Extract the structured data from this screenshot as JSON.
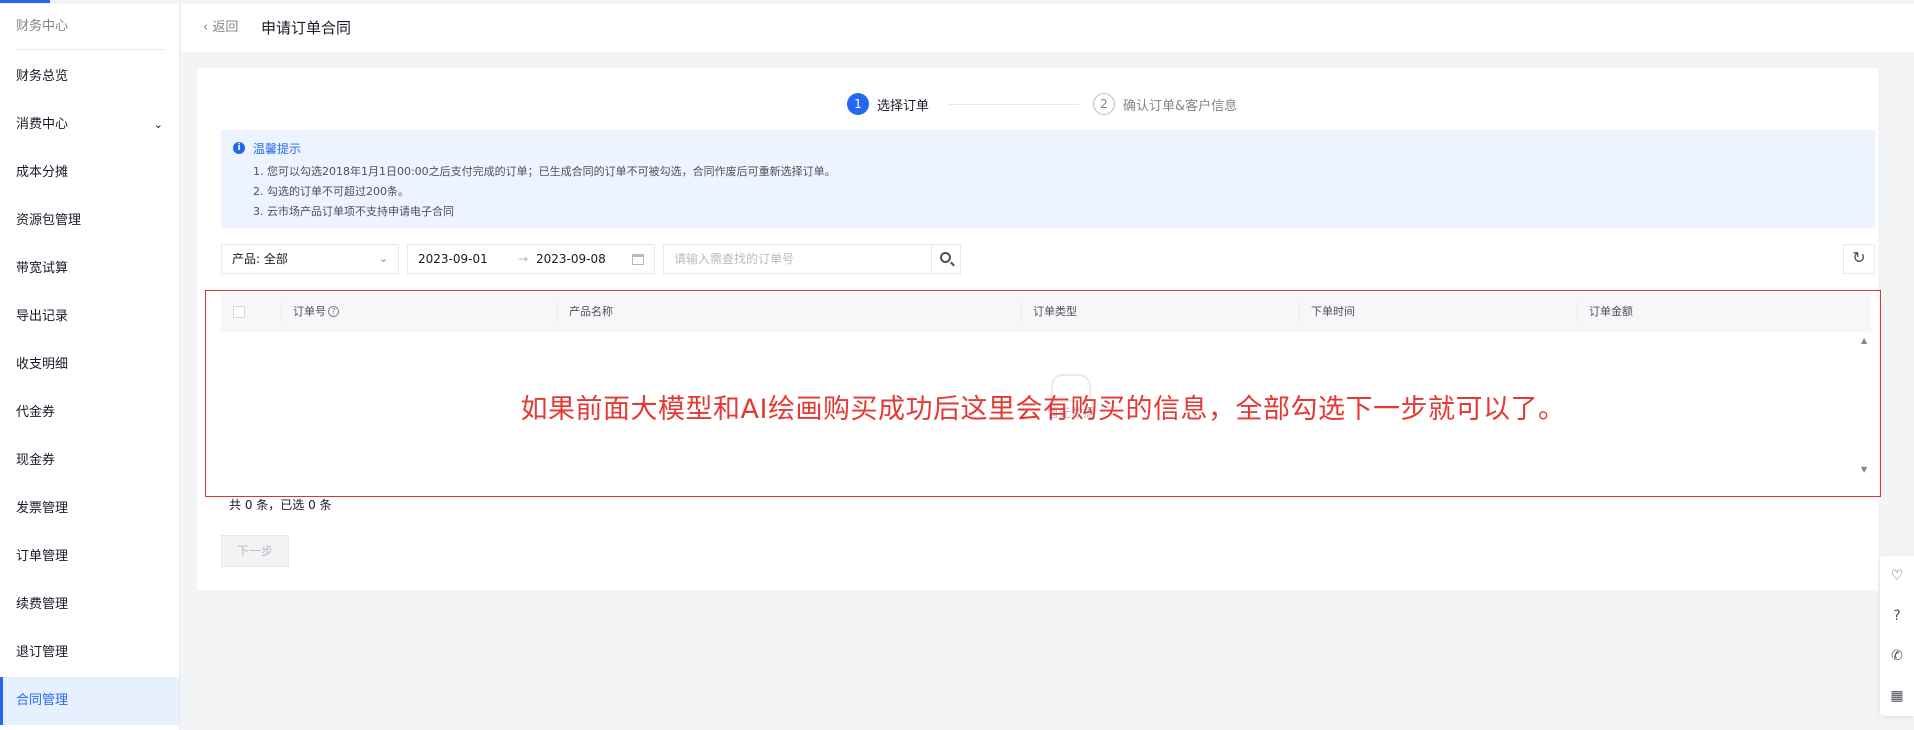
{
  "sidebar": {
    "title": "财务中心",
    "items": [
      {
        "label": "财务总览"
      },
      {
        "label": "消费中心",
        "has_children": true
      },
      {
        "label": "成本分摊"
      },
      {
        "label": "资源包管理"
      },
      {
        "label": "带宽试算"
      },
      {
        "label": "导出记录"
      },
      {
        "label": "收支明细"
      },
      {
        "label": "代金券"
      },
      {
        "label": "现金券"
      },
      {
        "label": "发票管理"
      },
      {
        "label": "订单管理"
      },
      {
        "label": "续费管理"
      },
      {
        "label": "退订管理"
      },
      {
        "label": "合同管理",
        "active": true
      }
    ]
  },
  "header": {
    "back_label": "返回",
    "title": "申请订单合同"
  },
  "steps": [
    {
      "num": "1",
      "label": "选择订单",
      "active": true
    },
    {
      "num": "2",
      "label": "确认订单&客户信息",
      "active": false
    }
  ],
  "notice": {
    "title": "温馨提示",
    "items": [
      "1.  您可以勾选2018年1月1日00:00之后支付完成的订单；已生成合同的订单不可被勾选，合同作废后可重新选择订单。",
      "2.  勾选的订单不可超过200条。",
      "3.  云市场产品订单项不支持申请电子合同"
    ]
  },
  "filters": {
    "product_select": "产品: 全部",
    "date_start": "2023-09-01",
    "date_sep": "→",
    "date_end": "2023-09-08",
    "search_placeholder": "请输入需查找的订单号"
  },
  "table": {
    "columns": [
      "订单号",
      "产品名称",
      "订单类型",
      "下单时间",
      "订单金额"
    ],
    "empty_text": "暂无数据"
  },
  "annotation": "如果前面大模型和AI绘画购买成功后这里会有购买的信息，全部勾选下一步就可以了。",
  "summary": "共 0 条，已选 0 条",
  "next_button": "下一步",
  "colors": {
    "primary": "#2468f2",
    "annotation_red": "#e53935",
    "notice_bg": "#eef4ff"
  },
  "float_tools": [
    "heart-icon",
    "help-icon",
    "phone-icon",
    "apps-icon"
  ]
}
